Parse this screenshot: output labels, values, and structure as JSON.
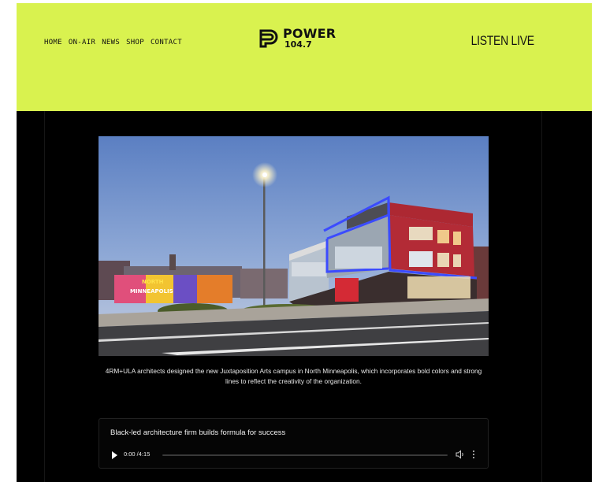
{
  "header": {
    "nav": [
      "HOME",
      "ON-AIR",
      "NEWS",
      "SHOP",
      "CONTACT"
    ],
    "logo_title": "POWER",
    "logo_sub": "104.7",
    "listen_live": "LISTEN LIVE",
    "colors": {
      "background": "#d9f24f",
      "text": "#111111"
    }
  },
  "article": {
    "caption": "4RM+ULA architects designed the new Juxtaposition Arts campus in North Minneapolis, which incorporates bold colors and strong lines to reflect the creativity of the organization."
  },
  "audio": {
    "title": "Black-led architecture firm builds formula for success",
    "time": "0:00 /4:15",
    "progress": 0,
    "icons": [
      "play-icon",
      "volume-icon",
      "more-options-icon"
    ]
  },
  "photo_labels": {
    "mural_word_1": "NORTH",
    "mural_word_2": "MINNEAPOLIS"
  }
}
